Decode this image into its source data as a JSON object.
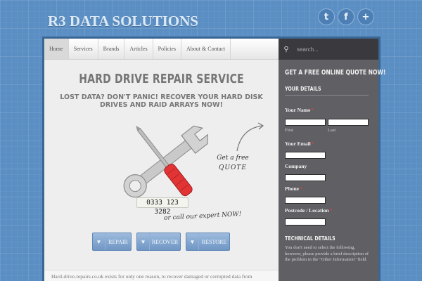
{
  "header": {
    "logo": "R3 DATA SOLUTIONS",
    "social": [
      {
        "icon": "twitter-icon",
        "glyph": "t"
      },
      {
        "icon": "facebook-icon",
        "glyph": "f"
      },
      {
        "icon": "plus-icon",
        "glyph": "+"
      }
    ]
  },
  "nav": {
    "items": [
      "Home",
      "Services",
      "Brands",
      "Articles",
      "Policies",
      "About & Contact"
    ]
  },
  "hero": {
    "title": "HARD DRIVE REPAIR SERVICE",
    "subtitle": "LOST DATA? DON'T PANIC! RECOVER YOUR HARD DISK DRIVES AND RAID ARRAYS NOW!",
    "phone": "0333 123 3282",
    "quote_note_line1": "Get a free",
    "quote_note_line2": "QUOTE",
    "call_note": "or call our expert NOW!",
    "buttons": [
      {
        "label": "REPAIR",
        "icon": "arrow-down-icon"
      },
      {
        "label": "RECOVER",
        "icon": "arrow-down-icon"
      },
      {
        "label": "RESTORE",
        "icon": "arrow-down-icon"
      }
    ]
  },
  "body_text": "Hard-drive-repairs.co.uk exists for only one reason, to recover damaged or corrupted data from",
  "sidebar": {
    "search_placeholder": "search...",
    "quote_heading": "GET A FREE ONLINE QUOTE NOW!",
    "details_heading": "YOUR DETAILS",
    "name_label": "Your Name",
    "first_label": "First",
    "last_label": "Last",
    "email_label": "Your Email",
    "company_label": "Company",
    "phone_label": "Phone",
    "postcode_label": "Postcode / Location",
    "required_mark": "*",
    "technical_heading": "TECHNICAL DETAILS",
    "technical_note": "You don't need to select the following, however, please provide a brief description of the problem in the \"Other Information\" field."
  },
  "colors": {
    "background": "#5b8fc4",
    "sidebar": "#5f5f64",
    "button": "#7ba0cc",
    "accent_red": "#e0403a"
  }
}
